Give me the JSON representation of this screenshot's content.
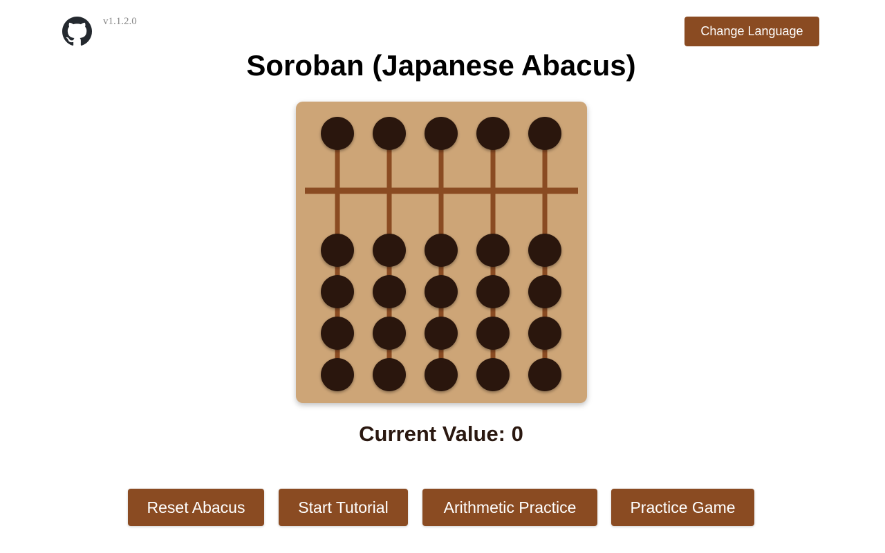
{
  "header": {
    "github_icon": "github-icon",
    "version": "v1.1.2.0",
    "change_language_label": "Change Language"
  },
  "title": "Soroban (Japanese Abacus)",
  "abacus": {
    "rods": 5,
    "heaven_beads_per_rod": 1,
    "earth_beads_per_rod": 4,
    "frame_color": "#cda577",
    "rod_color": "#8a4b22",
    "bead_color": "#2a1810"
  },
  "current_value": {
    "label": "Current Value: 0",
    "value": 0
  },
  "actions": {
    "reset_label": "Reset Abacus",
    "tutorial_label": "Start Tutorial",
    "arithmetic_label": "Arithmetic Practice",
    "game_label": "Practice Game"
  },
  "colors": {
    "accent": "#8a4b22",
    "text": "#000000"
  }
}
